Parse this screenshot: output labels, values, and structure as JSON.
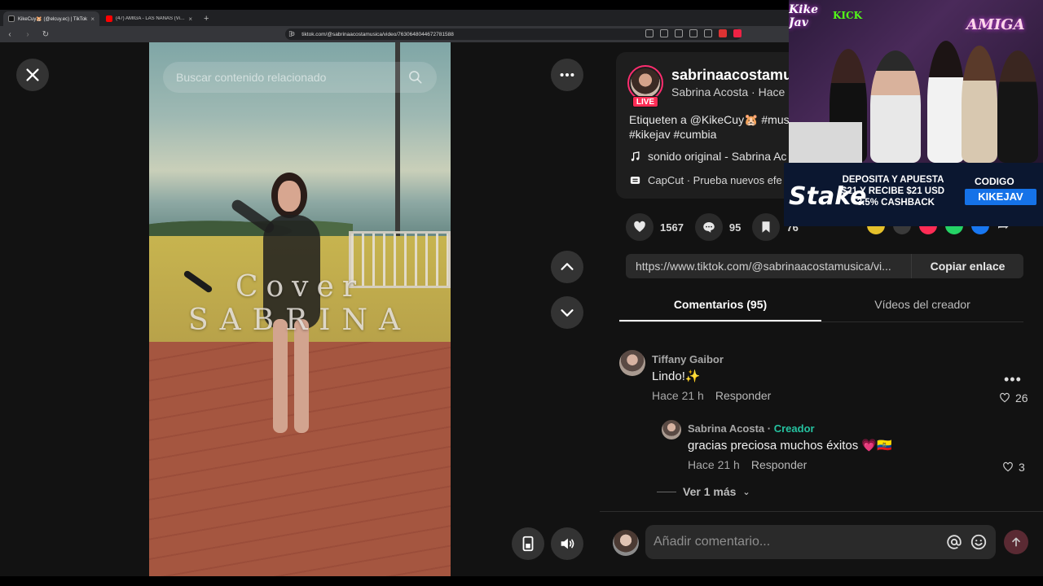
{
  "browser": {
    "tabs": [
      {
        "title": "KikeCuy🐹 (@elcuy.ec) | TikTok",
        "active": true,
        "favicon_color": "#111111"
      },
      {
        "title": "(47) AMIGA - LAS ÑAÑAS (Video Oficial)",
        "active": false,
        "favicon_color": "#ff0000"
      }
    ],
    "new_tab": "+",
    "url": "tiktok.com/@sabrinaacostamusica/video/7630648044672781588"
  },
  "video": {
    "search_placeholder": "Buscar contenido relacionado",
    "cover_line1": "Cover",
    "cover_line2": "SABRINA"
  },
  "post": {
    "username": "sabrinaacostamu",
    "display_name": "Sabrina Acosta · Hace",
    "live_badge": "LIVE",
    "caption_line1": "Etiqueten a @KikeCuy🐹 #mus",
    "caption_line2": "#kikejav #cumbia",
    "sound": "sonido original - Sabrina Ac",
    "capcut": "CapCut · Prueba nuevos efe",
    "likes": "1567",
    "comments": "95",
    "saves": "76",
    "link": "https://www.tiktok.com/@sabrinaacostamusica/vi...",
    "copy_label": "Copiar enlace"
  },
  "tabs": {
    "comments": "Comentarios (95)",
    "creator_videos": "Vídeos del creador"
  },
  "comments": [
    {
      "name": "Tiffany Gaibor",
      "text": "Lindo!✨",
      "time": "Hace 21 h",
      "reply": "Responder",
      "likes": "26"
    },
    {
      "name": "Sabrina Acosta",
      "badge": "Creador",
      "text": "gracias preciosa muchos éxitos 💗🇪🇨",
      "time": "Hace 21 h",
      "reply": "Responder",
      "likes": "3"
    }
  ],
  "more_replies": "Ver 1 más",
  "composer": {
    "placeholder": "Añadir comentario..."
  },
  "stream_overlay": {
    "neon_left": "Kike Jav",
    "neon_kick": "KICK",
    "neon_right": "AMIGA",
    "ad_logo": "Stake",
    "ad_promo_line1": "DEPOSITA Y APUESTA",
    "ad_promo_line2": "$21 Y  RECIBE $21 USD",
    "ad_promo_line3": "+3.5% CASHBACK",
    "code_label": "CODIGO",
    "code_value": "KIKEJAV"
  },
  "colors": {
    "accent": "#fe2c55",
    "creator": "#25c2a0",
    "panel_bg": "#121212"
  }
}
